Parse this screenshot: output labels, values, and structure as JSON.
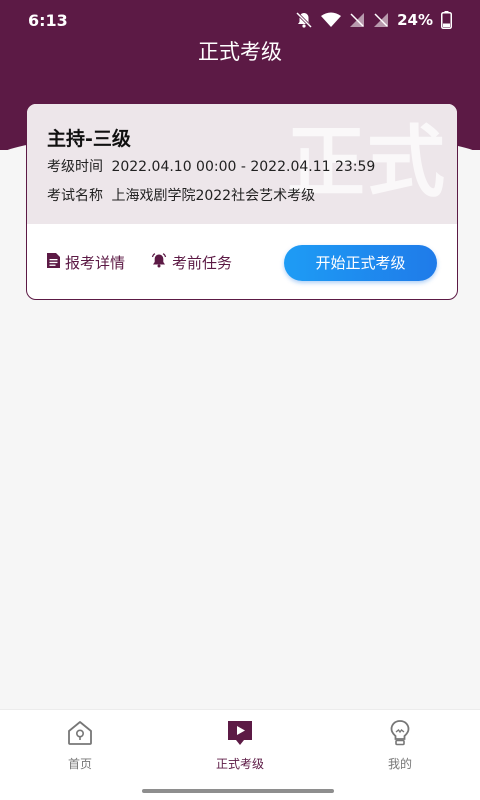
{
  "status_bar": {
    "time": "6:13",
    "battery": "24%"
  },
  "header": {
    "title": "正式考级"
  },
  "card": {
    "watermark": "正式",
    "title": "主持-三级",
    "time_label": "考级时间",
    "time_value": "2022.04.10 00:00 - 2022.04.11 23:59",
    "name_label": "考试名称",
    "name_value": "上海戏剧学院2022社会艺术考级",
    "actions": {
      "details_label": "报考详情",
      "tasks_label": "考前任务",
      "start_label": "开始正式考级"
    }
  },
  "tabbar": {
    "items": [
      {
        "label": "首页",
        "icon": "home-icon"
      },
      {
        "label": "正式考级",
        "icon": "exam-play-icon"
      },
      {
        "label": "我的",
        "icon": "bulb-icon"
      }
    ],
    "active_index": 1
  },
  "colors": {
    "brand": "#5c1a45",
    "accent": "#1e8ef0",
    "background": "#f6f6f6"
  }
}
